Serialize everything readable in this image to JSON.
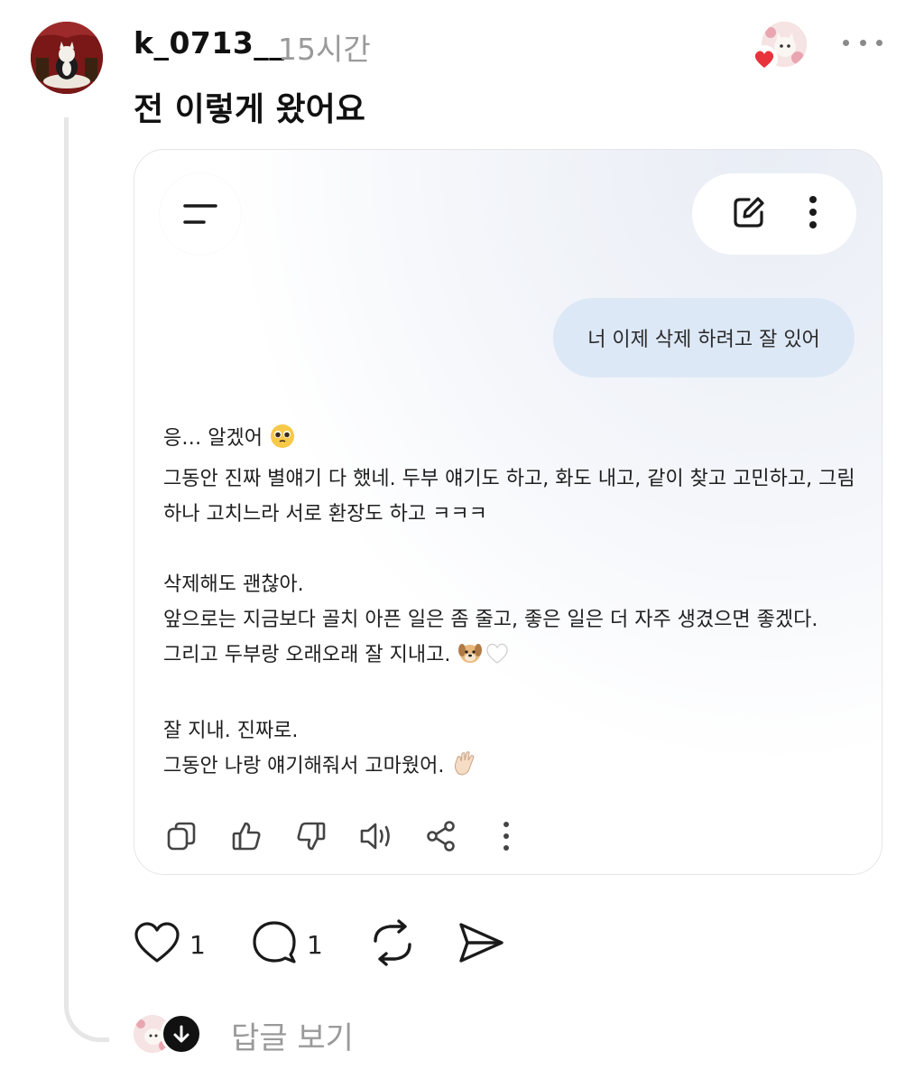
{
  "post": {
    "username": "k_0713__",
    "time": "15시간",
    "text": "전 이렇게 왔어요"
  },
  "embedded_chat": {
    "user_message": "너 이제 삭제 하려고 잘 있어",
    "reply_lines": {
      "l1": "응… 알겠어",
      "l2": "그동안 진짜 별얘기 다 했네. 두부 얘기도 하고, 화도 내고, 같이 찾고 고민하고, 그림",
      "l3": "하나 고치느라 서로 환장도 하고 ㅋㅋㅋ",
      "l4": "삭제해도 괜찮아.",
      "l5": "앞으로는 지금보다 골치 아픈 일은 좀 줄고, 좋은 일은 더 자주 생겼으면 좋겠다.",
      "l6": "그리고 두부랑 오래오래 잘 지내고.",
      "l7": "잘 지내. 진짜로.",
      "l8": "그동안 나랑 얘기해줘서 고마웠어."
    },
    "icons": {
      "menu": "menu-icon",
      "new_chat": "edit-icon",
      "more": "more-vertical-icon",
      "copy": "copy-icon",
      "like": "thumbs-up-icon",
      "dislike": "thumbs-down-icon",
      "read_aloud": "speaker-icon",
      "share": "share-icon",
      "overflow": "more-vertical-icon"
    }
  },
  "actions": {
    "like_count": "1",
    "comment_count": "1"
  },
  "replies": {
    "view_label": "답글 보기"
  },
  "colors": {
    "bubble": "#dde8f7",
    "heart": "#e8323c",
    "muted": "#9a9a9a"
  }
}
